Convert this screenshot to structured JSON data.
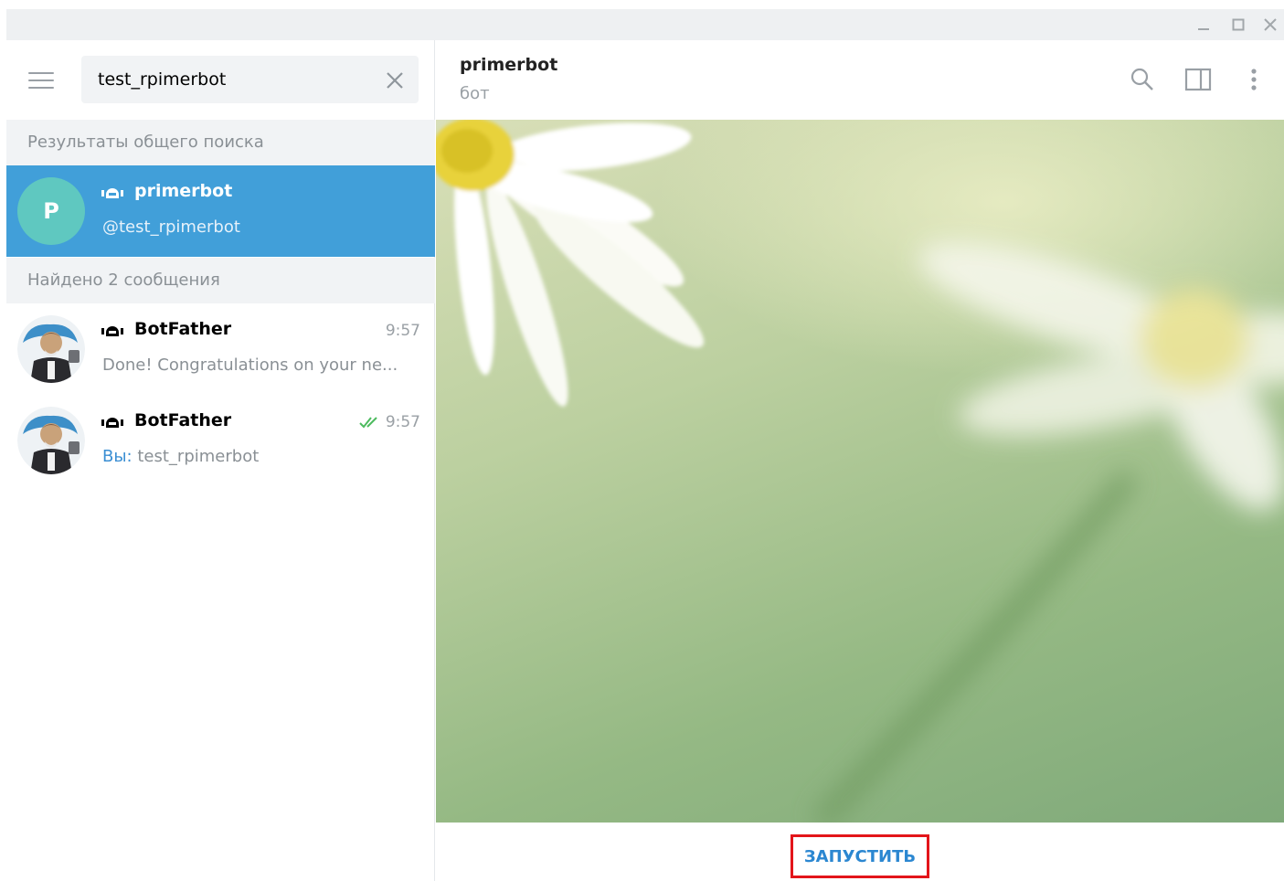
{
  "search": {
    "query": "test_rpimerbot"
  },
  "sections": {
    "global": "Результаты общего поиска",
    "messages": "Найдено 2 сообщения"
  },
  "global_result": {
    "avatar_letter": "P",
    "name": "primerbot",
    "username": "@test_rpimerbot"
  },
  "message_results": [
    {
      "name": "BotFather",
      "time": "9:57",
      "preview": "Done! Congratulations on your ne..."
    },
    {
      "name": "BotFather",
      "time": "9:57",
      "sender": "Вы:",
      "preview": "test_rpimerbot"
    }
  ],
  "chat": {
    "title": "primerbot",
    "status": "бот",
    "start_label": "ЗАПУСТИТЬ"
  },
  "colors": {
    "accent": "#419fd9",
    "start_text": "#2b87d1",
    "highlight_border": "#e3151a",
    "check": "#4dbb5f"
  },
  "icons": {
    "menu": "hamburger-icon",
    "clear": "close-icon",
    "bot": "bot-icon",
    "read": "double-check-icon",
    "search": "search-icon",
    "panel": "sidebar-toggle-icon",
    "more": "more-vertical-icon"
  }
}
